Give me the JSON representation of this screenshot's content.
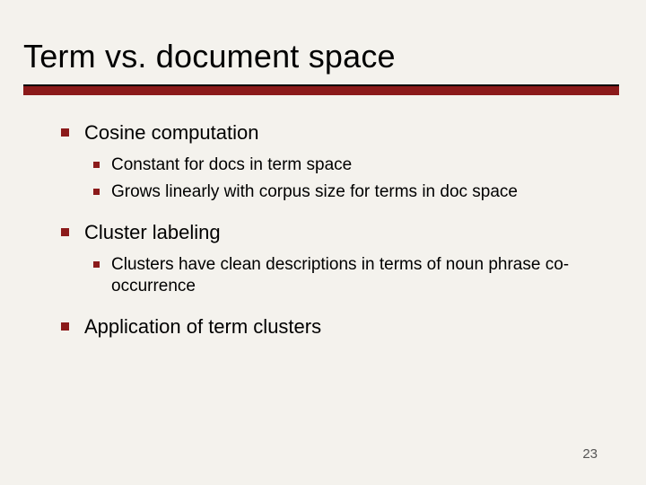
{
  "title": "Term vs. document space",
  "bullets": [
    {
      "text": "Cosine computation",
      "children": [
        {
          "text": "Constant for docs in term space"
        },
        {
          "text": "Grows linearly with corpus size for terms in doc space"
        }
      ]
    },
    {
      "text": "Cluster labeling",
      "children": [
        {
          "text": "Clusters have clean descriptions in terms of noun phrase co-occurrence"
        }
      ]
    },
    {
      "text": "Application of term clusters",
      "children": []
    }
  ],
  "page_number": "23"
}
